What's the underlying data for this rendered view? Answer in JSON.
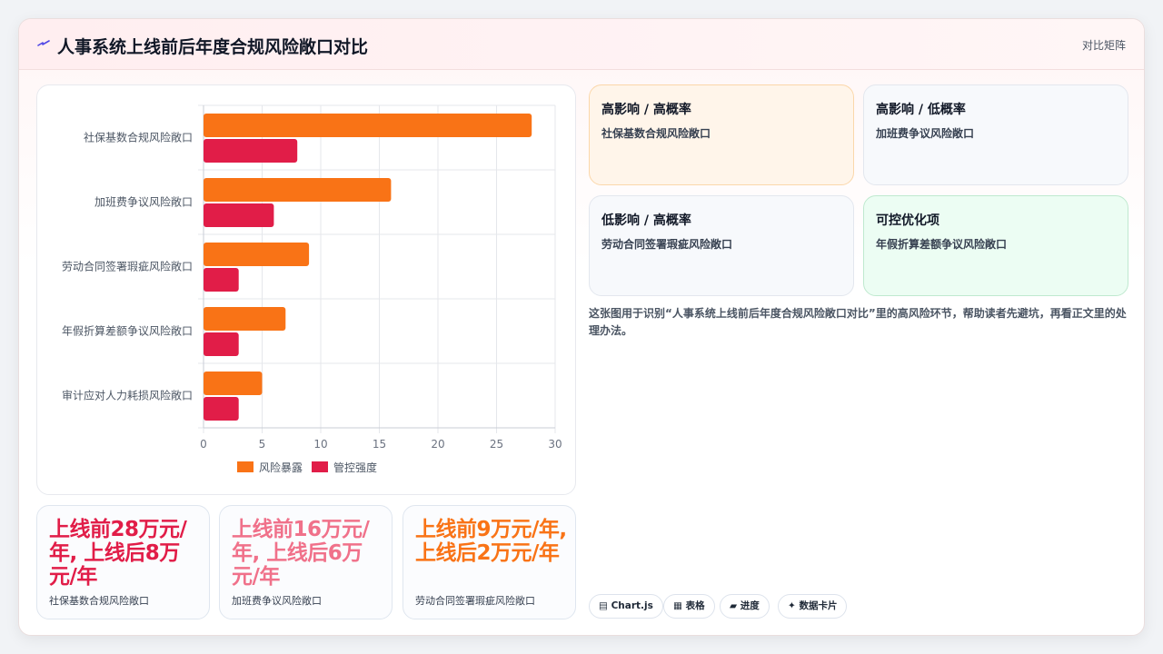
{
  "header": {
    "title": "人事系统上线前后年度合规风险敞口对比",
    "matrix_link": "对比矩阵",
    "accent": "#4f46e5"
  },
  "chart_data": {
    "type": "bar",
    "orientation": "horizontal",
    "categories": [
      "社保基数合规风险敞口",
      "加班费争议风险敞口",
      "劳动合同签署瑕疵风险敞口",
      "年假折算差额争议风险敞口",
      "审计应对人力耗损风险敞口"
    ],
    "series": [
      {
        "name": "风险暴露",
        "values": [
          28,
          16,
          9,
          7,
          5
        ],
        "color": "#f97316"
      },
      {
        "name": "管控强度",
        "values": [
          8,
          6,
          3,
          3,
          3
        ],
        "color": "#e11d48"
      }
    ],
    "xlim": [
      0,
      30
    ],
    "xticks": [
      0,
      5,
      10,
      15,
      20,
      25,
      30
    ],
    "grid": true,
    "legend": "bottom"
  },
  "stats": [
    {
      "value": "上线前28万元/年, 上线后8万元/年",
      "label": "社保基数合规风险敞口",
      "color": "#e11d48"
    },
    {
      "value": "上线前16万元/年, 上线后6万元/年",
      "label": "加班费争议风险敞口",
      "color": "#f0718a"
    },
    {
      "value": "上线前9万元/年, 上线后2万元/年",
      "label": "劳动合同签署瑕疵风险敞口",
      "color": "#f97316"
    }
  ],
  "quadrants": [
    {
      "title": "高影响 / 高概率",
      "item": "社保基数合规风险敞口",
      "bg": "#fff5ea",
      "border": "#fbd7aa"
    },
    {
      "title": "高影响 / 低概率",
      "item": "加班费争议风险敞口",
      "bg": "#f7f9fc",
      "border": "#e3e7ee"
    },
    {
      "title": "低影响 / 高概率",
      "item": "劳动合同签署瑕疵风险敞口",
      "bg": "#f7f9fc",
      "border": "#e3e7ee"
    },
    {
      "title": "可控优化项",
      "item": "年假折算差额争议风险敞口",
      "bg": "#ecfdf3",
      "border": "#bfe9cf"
    }
  ],
  "description": "这张图用于识别“人事系统上线前后年度合规风险敞口对比”里的高风险环节，帮助读者先避坑，再看正文里的处理办法。",
  "tags": [
    {
      "icon": "▤",
      "label": "Chart.js"
    },
    {
      "icon": "▦",
      "label": "表格"
    },
    {
      "icon": "▰",
      "label": "进度"
    },
    {
      "icon": "✦",
      "label": "数据卡片"
    }
  ]
}
